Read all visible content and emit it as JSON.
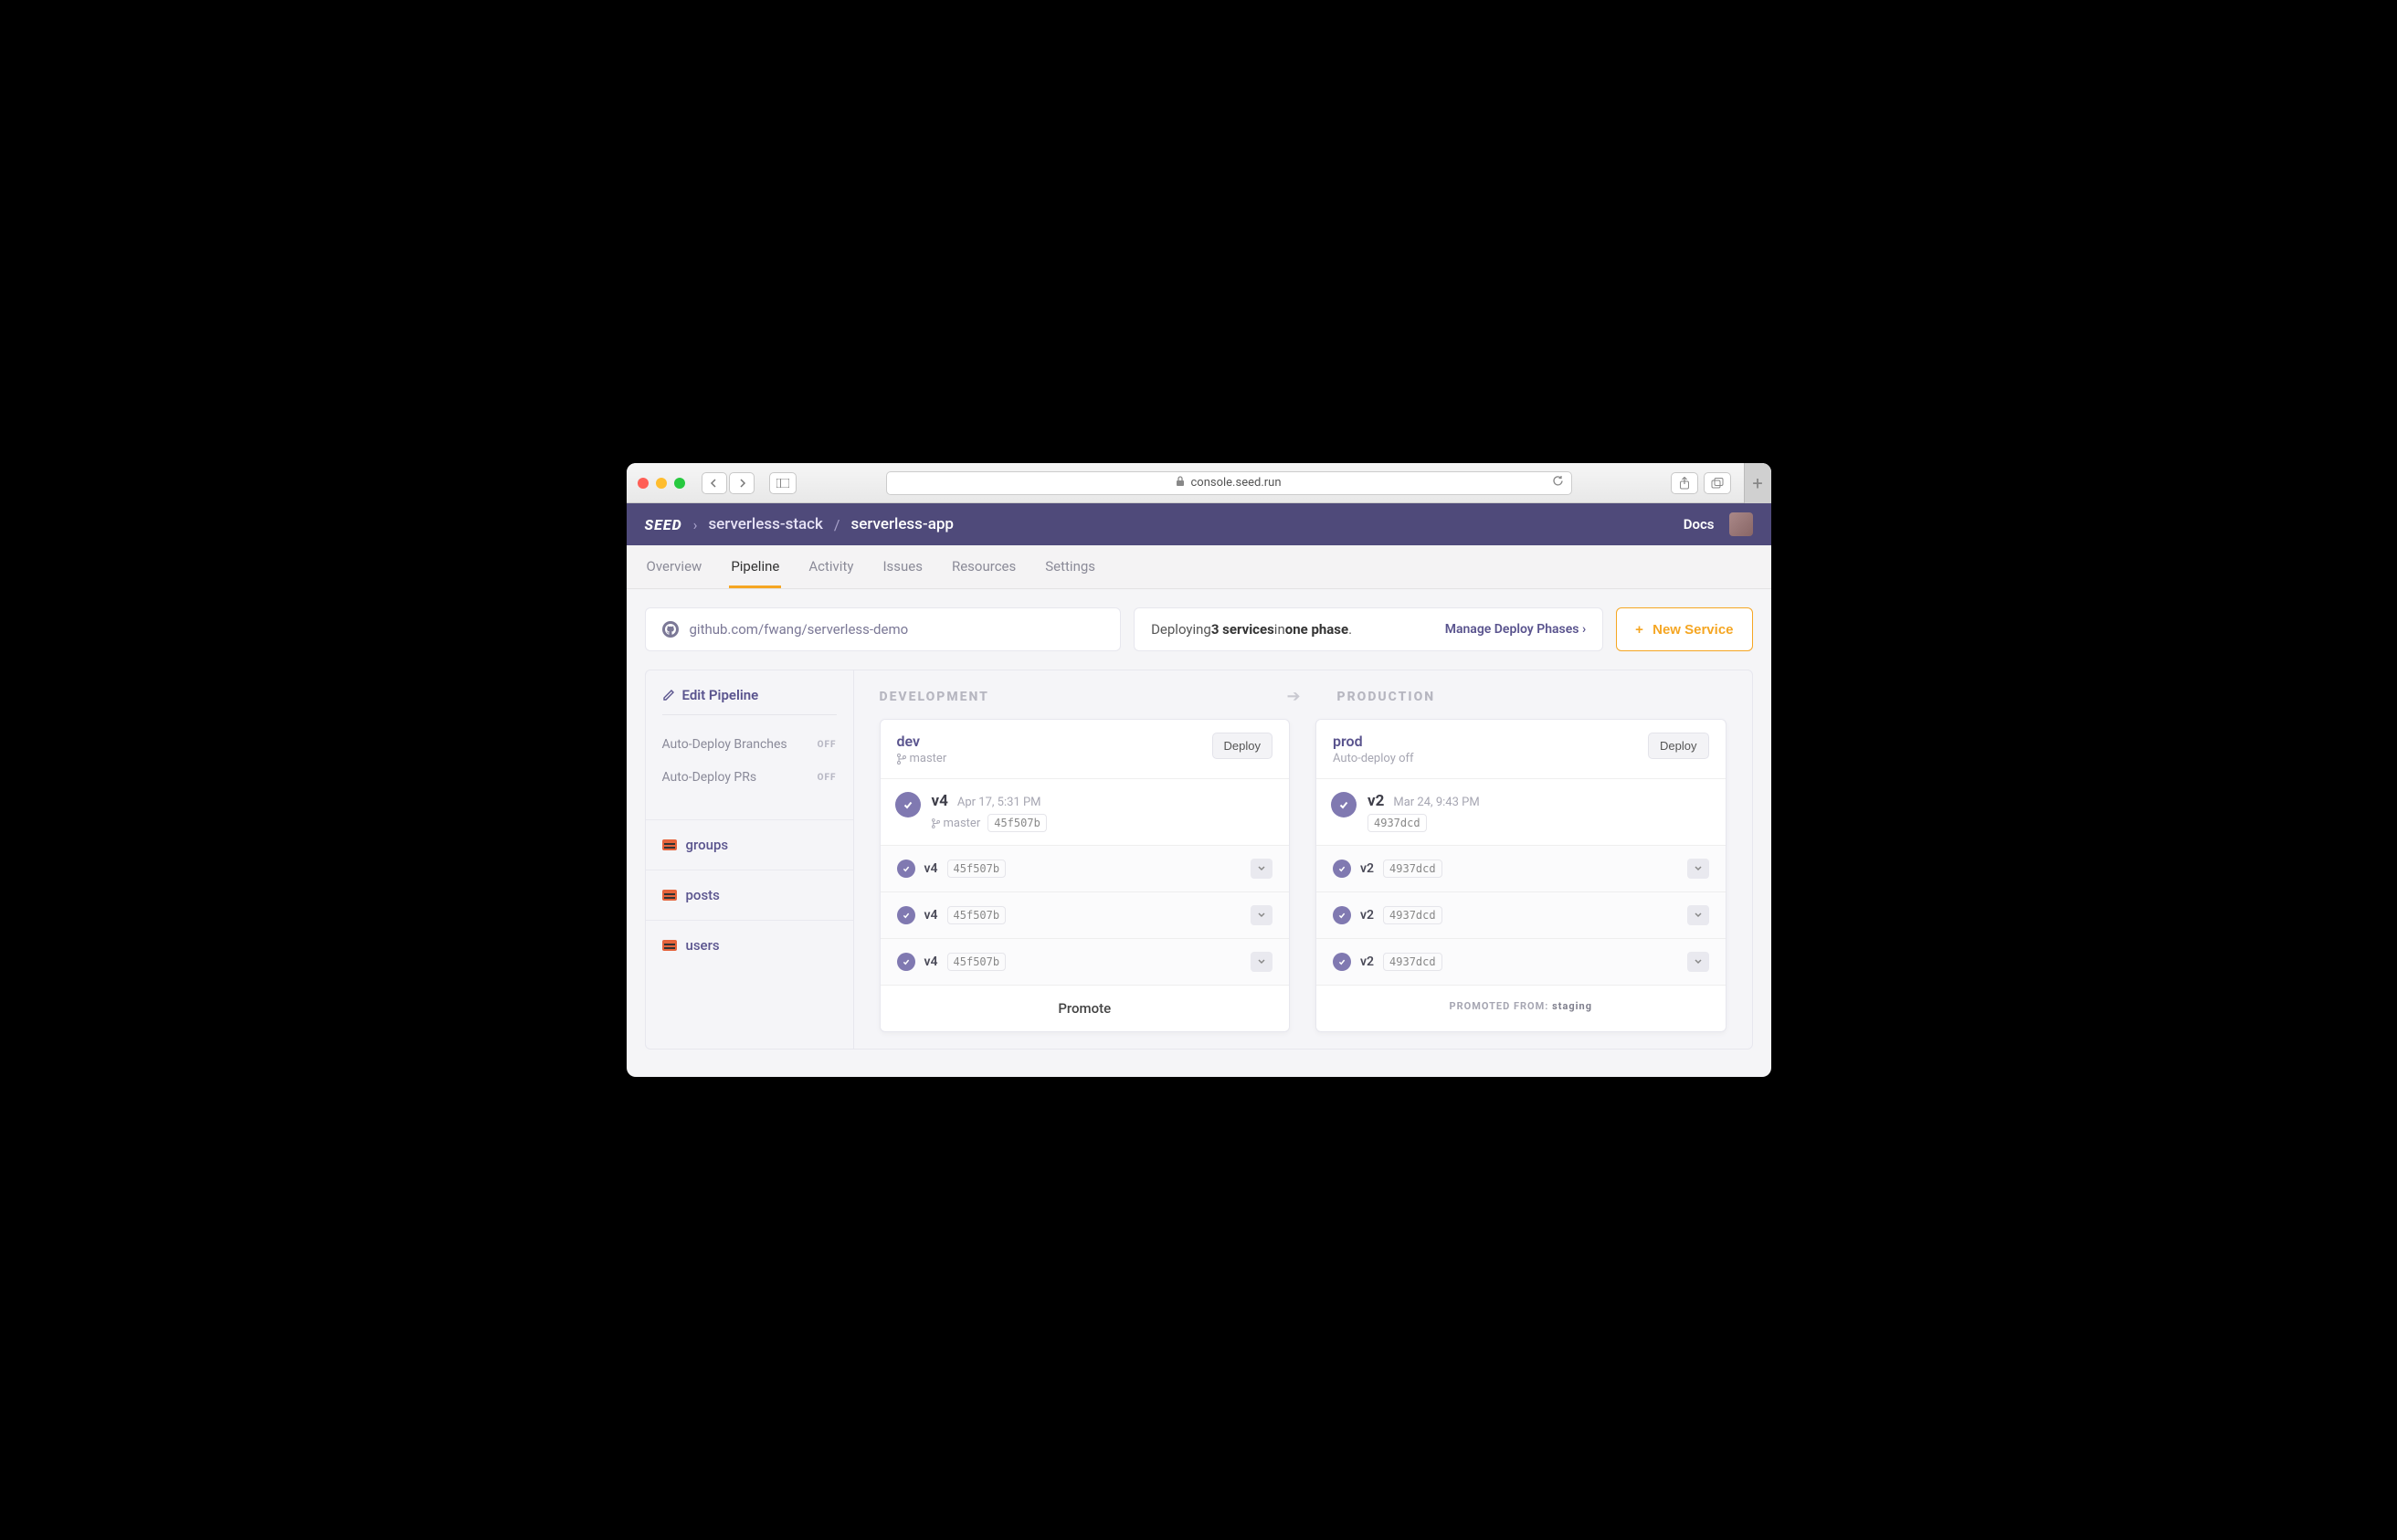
{
  "browser": {
    "url": "console.seed.run"
  },
  "header": {
    "logo": "SEED",
    "crumbs": [
      "serverless-stack",
      "serverless-app"
    ],
    "docs": "Docs"
  },
  "tabs": [
    "Overview",
    "Pipeline",
    "Activity",
    "Issues",
    "Resources",
    "Settings"
  ],
  "active_tab": "Pipeline",
  "repo": {
    "url": "github.com/fwang/serverless-demo"
  },
  "deploy_strip": {
    "prefix": "Deploying ",
    "services": "3 services",
    "mid": " in ",
    "phase": "one phase",
    "suffix": ".",
    "manage": "Manage Deploy Phases",
    "new_service": "New Service"
  },
  "sidebar": {
    "edit": "Edit Pipeline",
    "rows": [
      {
        "label": "Auto-Deploy Branches",
        "state": "OFF"
      },
      {
        "label": "Auto-Deploy PRs",
        "state": "OFF"
      }
    ],
    "services": [
      "groups",
      "posts",
      "users"
    ]
  },
  "columns": {
    "dev": "DEVELOPMENT",
    "prod": "PRODUCTION"
  },
  "stages": {
    "dev": {
      "name": "dev",
      "sub_branch": "master",
      "deploy_btn": "Deploy",
      "build": {
        "ver": "v4",
        "time": "Apr 17, 5:31 PM",
        "branch": "master",
        "sha": "45f507b"
      },
      "rows": [
        {
          "ver": "v4",
          "sha": "45f507b"
        },
        {
          "ver": "v4",
          "sha": "45f507b"
        },
        {
          "ver": "v4",
          "sha": "45f507b"
        }
      ],
      "footer": "Promote"
    },
    "prod": {
      "name": "prod",
      "sub_text": "Auto-deploy off",
      "deploy_btn": "Deploy",
      "build": {
        "ver": "v2",
        "time": "Mar 24, 9:43 PM",
        "sha": "4937dcd"
      },
      "rows": [
        {
          "ver": "v2",
          "sha": "4937dcd"
        },
        {
          "ver": "v2",
          "sha": "4937dcd"
        },
        {
          "ver": "v2",
          "sha": "4937dcd"
        }
      ],
      "footer_pre": "PROMOTED FROM: ",
      "footer_val": "staging"
    }
  }
}
